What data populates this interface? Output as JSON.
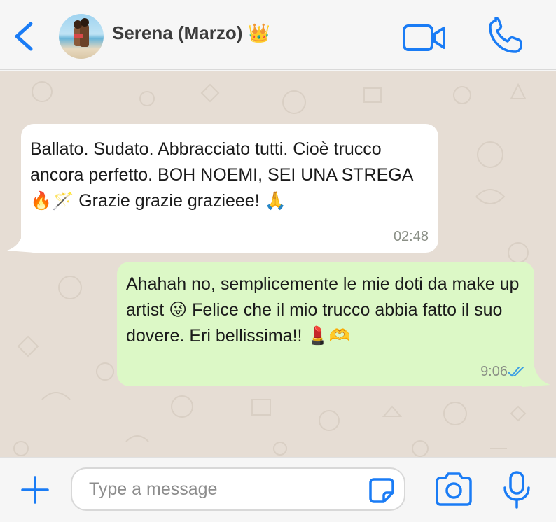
{
  "header": {
    "contact_name": "Serena (Marzo) 👑",
    "icons": {
      "back": "chevron-left-icon",
      "video": "video-camera-icon",
      "call": "phone-icon"
    }
  },
  "messages": [
    {
      "direction": "incoming",
      "text": "Ballato. Sudato. Abbracciato tutti. Cioè trucco ancora perfetto. BOH NOEMI, SEI UNA STREGA 🔥🪄 Grazie grazie grazieee! 🙏",
      "time": "02:48"
    },
    {
      "direction": "outgoing",
      "text": "Ahahah no, semplicemente le mie doti da make up artist 😜 Felice che il mio trucco abbia fatto il suo dovere. Eri bellissima!! 💄🫶",
      "time": "9:06",
      "status": "read"
    }
  ],
  "composer": {
    "placeholder": "Type a message",
    "value": ""
  },
  "colors": {
    "accent": "#1a7cf5",
    "chat_background": "#e6ddd4",
    "incoming_bubble": "#ffffff",
    "outgoing_bubble": "#dcf8c6",
    "read_ticks": "#3d9fe3"
  }
}
